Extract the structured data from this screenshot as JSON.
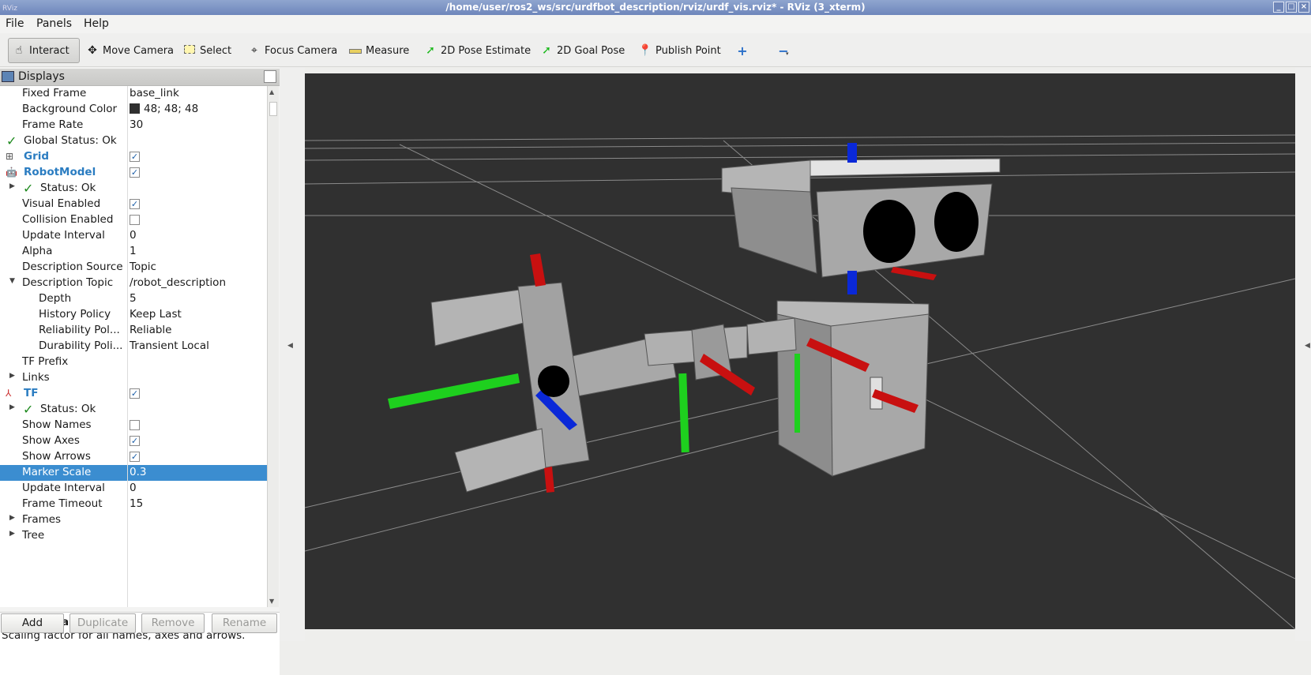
{
  "window": {
    "title": "/home/user/ros2_ws/src/urdfbot_description/rviz/urdf_vis.rviz* - RViz (3_xterm)",
    "app_icon": "RViz"
  },
  "menu": [
    "File",
    "Panels",
    "Help"
  ],
  "toolbar": [
    {
      "label": "Interact",
      "icon": "hand-icon",
      "active": true
    },
    {
      "label": "Move Camera",
      "icon": "move-camera-icon"
    },
    {
      "label": "Select",
      "icon": "select-icon"
    },
    {
      "label": "Focus Camera",
      "icon": "focus-camera-icon"
    },
    {
      "label": "Measure",
      "icon": "ruler-icon"
    },
    {
      "label": "2D Pose Estimate",
      "icon": "pose-arrow-icon"
    },
    {
      "label": "2D Goal Pose",
      "icon": "goal-arrow-icon"
    },
    {
      "label": "Publish Point",
      "icon": "map-pin-icon"
    }
  ],
  "displays": {
    "title": "Displays",
    "rows": [
      {
        "label": "Fixed Frame",
        "value": "base_link"
      },
      {
        "label": "Background Color",
        "value": "48; 48; 48"
      },
      {
        "label": "Frame Rate",
        "value": "30"
      },
      {
        "label": "Global Status: Ok"
      },
      {
        "label": "Grid"
      },
      {
        "label": "RobotModel"
      },
      {
        "label": "Status: Ok"
      },
      {
        "label": "Visual Enabled"
      },
      {
        "label": "Collision Enabled"
      },
      {
        "label": "Update Interval",
        "value": "0"
      },
      {
        "label": "Alpha",
        "value": "1"
      },
      {
        "label": "Description Source",
        "value": "Topic"
      },
      {
        "label": "Description Topic",
        "value": "/robot_description"
      },
      {
        "label": "Depth",
        "value": "5"
      },
      {
        "label": "History Policy",
        "value": "Keep Last"
      },
      {
        "label": "Reliability Pol...",
        "value": "Reliable"
      },
      {
        "label": "Durability Poli...",
        "value": "Transient Local"
      },
      {
        "label": "TF Prefix"
      },
      {
        "label": "Links"
      },
      {
        "label": "TF"
      },
      {
        "label": "Status: Ok"
      },
      {
        "label": "Show Names"
      },
      {
        "label": "Show Axes"
      },
      {
        "label": "Show Arrows"
      },
      {
        "label": "Marker Scale",
        "value": "0.3"
      },
      {
        "label": "Update Interval",
        "value": "0"
      },
      {
        "label": "Frame Timeout",
        "value": "15"
      },
      {
        "label": "Frames"
      },
      {
        "label": "Tree"
      }
    ]
  },
  "description": {
    "title": "Marker Scale",
    "text": "Scaling factor for all names, axes and arrows."
  },
  "buttons": {
    "add": "Add",
    "duplicate": "Duplicate",
    "remove": "Remove",
    "rename": "Rename"
  },
  "colors": {
    "background": "#303030",
    "selection": "#3b8dd0",
    "bold_display": "#2a7cc1"
  }
}
